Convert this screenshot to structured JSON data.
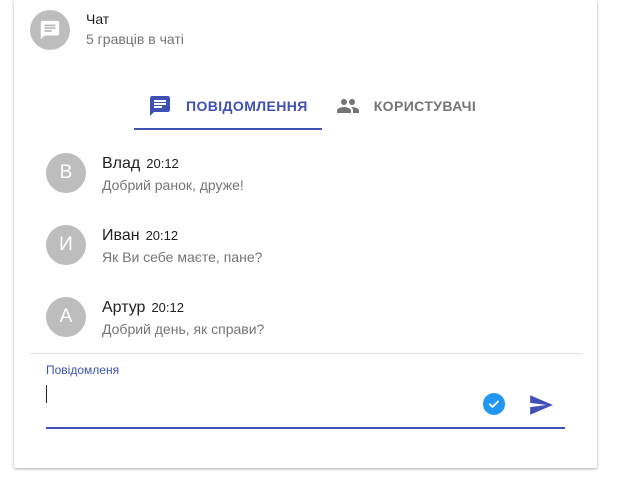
{
  "header": {
    "title": "Чат",
    "subtitle": "5 гравців в чаті",
    "icon": "chat-icon"
  },
  "tabs": [
    {
      "label": "ПОВІДОМЛЕННЯ",
      "icon": "message-icon",
      "active": true
    },
    {
      "label": "КОРИСТУВАЧІ",
      "icon": "people-icon",
      "active": false
    }
  ],
  "messages": [
    {
      "initial": "В",
      "name": "Влад",
      "time": "20:12",
      "text": "Добрий ранок, друже!"
    },
    {
      "initial": "И",
      "name": "Иван",
      "time": "20:12",
      "text": "Як Ви себе маєте, пане?"
    },
    {
      "initial": "А",
      "name": "Артур",
      "time": "20:12",
      "text": "Добрий день, як справи?"
    }
  ],
  "composer": {
    "label": "Повідомленя",
    "value": ""
  },
  "colors": {
    "accent": "#3f51b5",
    "avatar": "#bdbdbd",
    "check": "#2196f3"
  }
}
